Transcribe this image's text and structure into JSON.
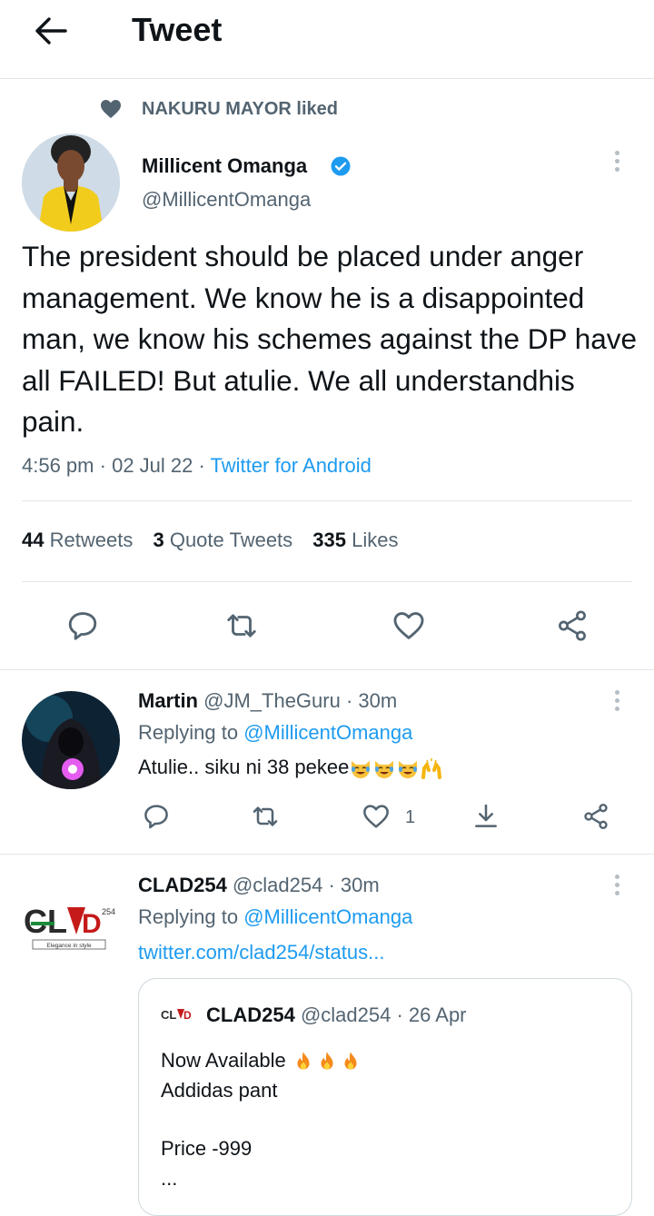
{
  "header": {
    "title": "Tweet"
  },
  "social_context": {
    "text": "NAKURU MAYOR liked"
  },
  "main_tweet": {
    "author_name": "Millicent Omanga",
    "handle": "@MillicentOmanga",
    "text": "The president should be placed under anger management. We know he is a disappointed man, we know his schemes against the DP have all FAILED! But atulie. We all understandhis pain.",
    "time": "4:56 pm",
    "date": "02 Jul 22",
    "source": "Twitter for Android",
    "sep": "·",
    "stats": {
      "retweets_count": "44",
      "retweets_label": "Retweets",
      "quotes_count": "3",
      "quotes_label": "Quote Tweets",
      "likes_count": "335",
      "likes_label": "Likes"
    }
  },
  "replies": [
    {
      "name": "Martin",
      "handle": "@JM_TheGuru",
      "time": "· 30m",
      "replying_prefix": "Replying to",
      "replying_to": "@MillicentOmanga",
      "text": "Atulie.. siku ni 38  pekee",
      "like_count": "1"
    },
    {
      "name": "CLAD254",
      "handle": "@clad254",
      "time": "· 30m",
      "replying_prefix": "Replying to",
      "replying_to": "@MillicentOmanga",
      "link": "twitter.com/clad254/status...",
      "avatar_tag": "Elegance in style",
      "quoted": {
        "name": "CLAD254",
        "handle": "@clad254",
        "date": "· 26 Apr",
        "line1": "Now Available",
        "line2": "Addidas pant",
        "line3": "Price -999",
        "line4": "..."
      }
    }
  ],
  "colors": {
    "accent": "#1d9bf0",
    "secondary_text": "#536471",
    "divider": "#e1e6ea"
  }
}
